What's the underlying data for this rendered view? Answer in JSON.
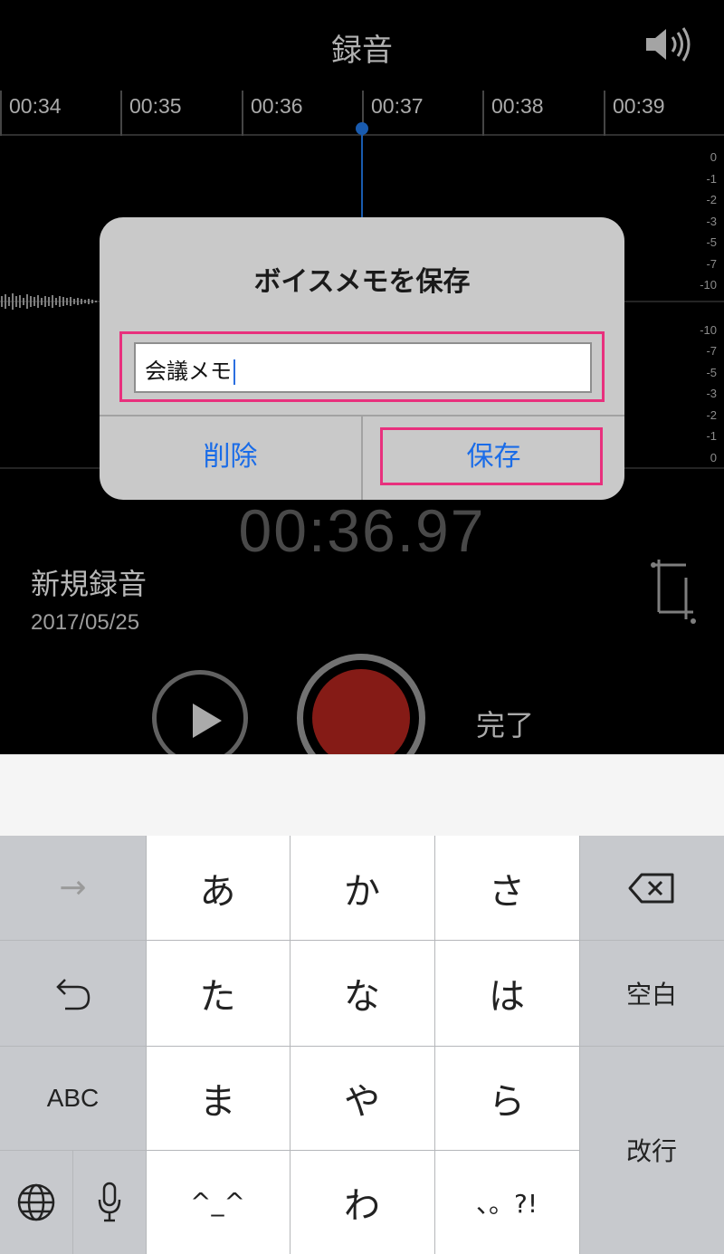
{
  "header": {
    "title": "録音"
  },
  "timeline": {
    "ticks": [
      "00:34",
      "00:35",
      "00:36",
      "00:37",
      "00:38",
      "00:39"
    ]
  },
  "db_scale": {
    "upper": [
      "0",
      "-1",
      "-2",
      "-3",
      "-5",
      "-7",
      "-10"
    ],
    "lower": [
      "-10",
      "-7",
      "-5",
      "-3",
      "-2",
      "-1",
      "0"
    ]
  },
  "timer": {
    "value": "00:36.97"
  },
  "recording": {
    "name": "新規録音",
    "date": "2017/05/25"
  },
  "controls": {
    "done_label": "完了"
  },
  "dialog": {
    "title": "ボイスメモを保存",
    "field_value": "会議メモ",
    "delete_label": "削除",
    "save_label": "保存"
  },
  "keyboard": {
    "row1": [
      "→",
      "あ",
      "か",
      "さ",
      "⌫"
    ],
    "row2": [
      "↺",
      "た",
      "な",
      "は",
      "空白"
    ],
    "row3": [
      "ABC",
      "ま",
      "や",
      "ら",
      "改行"
    ],
    "row4": [
      "globe",
      "mic",
      "^_^",
      "わ",
      "、。?!"
    ]
  },
  "colors": {
    "accent": "#1a6ce8",
    "record": "#a3221c",
    "highlight": "#e8307d"
  },
  "icons": {
    "speaker": "speaker-icon",
    "trim": "trim-icon",
    "play": "play-icon",
    "backspace": "backspace-icon",
    "undo": "undo-icon",
    "globe": "globe-icon",
    "mic": "mic-icon"
  }
}
